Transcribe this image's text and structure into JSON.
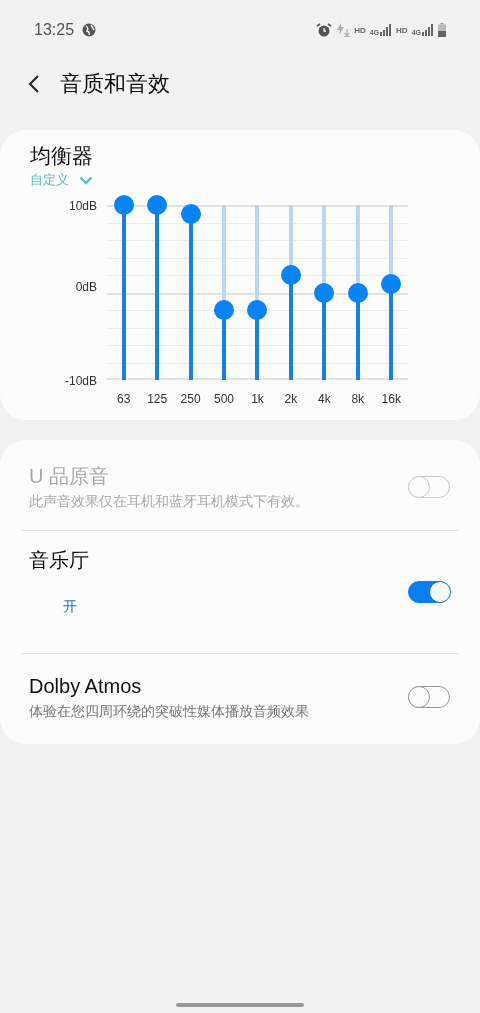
{
  "status_bar": {
    "time": "13:25",
    "indicators": [
      {
        "kind": "globe"
      },
      {
        "kind": "alarm"
      },
      {
        "kind": "charging"
      },
      {
        "kind": "text",
        "label": "HD"
      },
      {
        "kind": "signal",
        "label": "4G"
      },
      {
        "kind": "text",
        "label": "HD"
      },
      {
        "kind": "signal",
        "label": "4G"
      },
      {
        "kind": "battery"
      }
    ]
  },
  "header": {
    "title": "音质和音效"
  },
  "equalizer": {
    "title": "均衡器",
    "preset": "自定义",
    "y_labels": [
      "10dB",
      "0dB",
      "-10dB"
    ],
    "bands": [
      {
        "label": "63",
        "level": 1
      },
      {
        "label": "125",
        "level": 1
      },
      {
        "label": "250",
        "level": 0.95
      },
      {
        "label": "500",
        "level": 0.4
      },
      {
        "label": "1k",
        "level": 0.4
      },
      {
        "label": "2k",
        "level": 0.6
      },
      {
        "label": "4k",
        "level": 0.5
      },
      {
        "label": "8k",
        "level": 0.5
      },
      {
        "label": "16k",
        "level": 0.55
      }
    ]
  },
  "settings": [
    {
      "title": "U 品原音",
      "subtitle": "此声音效果仅在耳机和蓝牙耳机模式下有效。",
      "kind": "description",
      "on": false,
      "disabled": true
    },
    {
      "title": "音乐厅",
      "subtitle": "开",
      "kind": "status",
      "on": true,
      "disabled": false
    },
    {
      "title": "Dolby Atmos",
      "subtitle": "体验在您四周环绕的突破性媒体播放音频效果",
      "kind": "description",
      "on": false,
      "disabled": false
    }
  ]
}
